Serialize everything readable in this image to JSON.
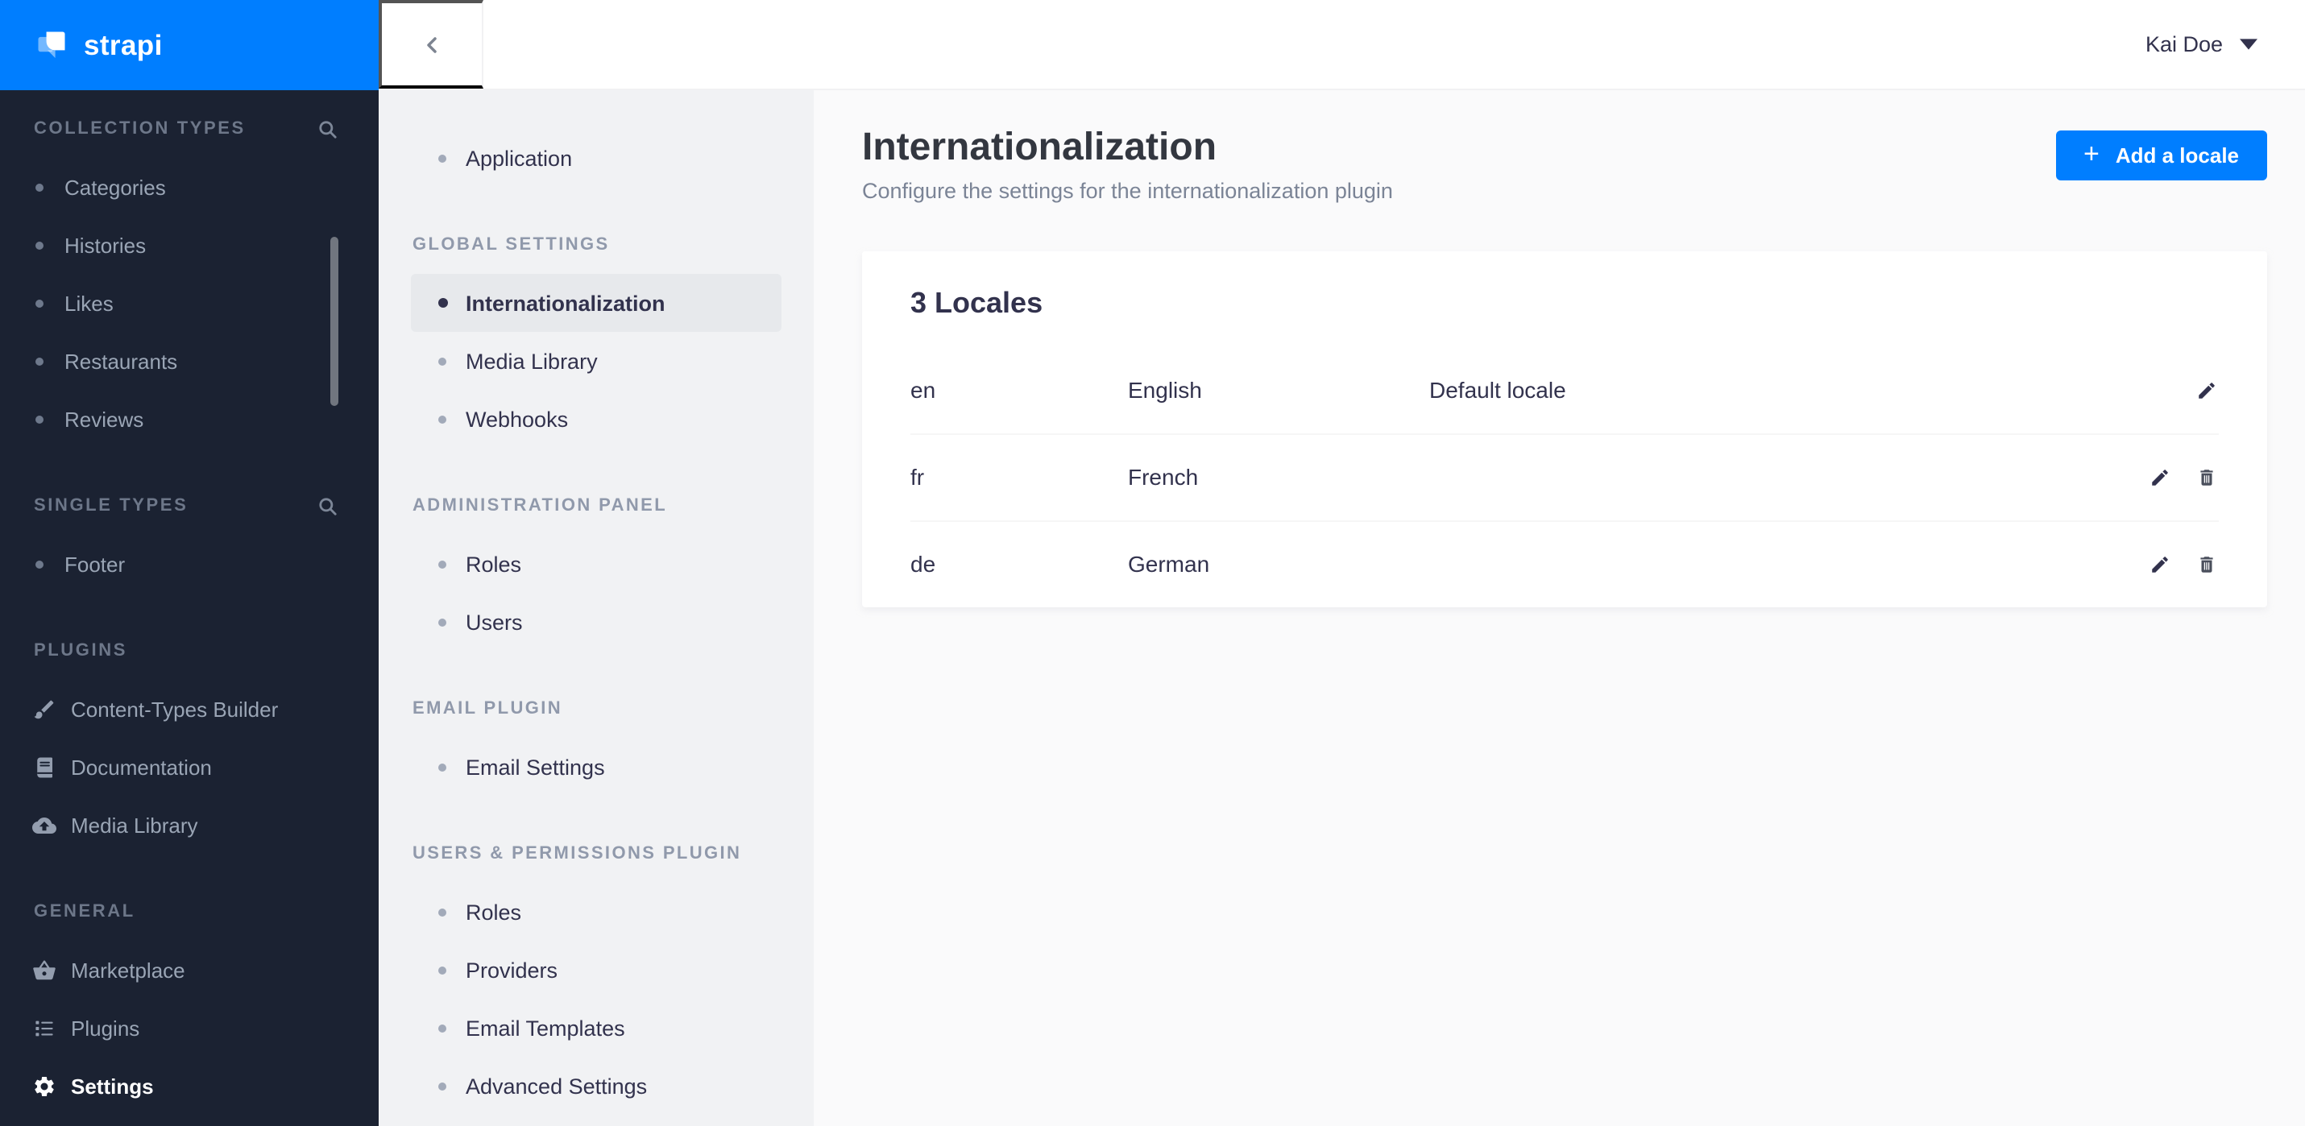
{
  "brand": {
    "logo_text": "strapi"
  },
  "topbar": {
    "user_name": "Kai Doe"
  },
  "main_nav": {
    "sections": [
      {
        "header": "COLLECTION TYPES",
        "items": [
          {
            "label": "Categories"
          },
          {
            "label": "Histories"
          },
          {
            "label": "Likes"
          },
          {
            "label": "Restaurants"
          },
          {
            "label": "Reviews"
          }
        ]
      },
      {
        "header": "SINGLE TYPES",
        "items": [
          {
            "label": "Footer"
          }
        ]
      },
      {
        "header": "PLUGINS",
        "items": [
          {
            "label": "Content-Types Builder"
          },
          {
            "label": "Documentation"
          },
          {
            "label": "Media Library"
          }
        ]
      },
      {
        "header": "GENERAL",
        "items": [
          {
            "label": "Marketplace"
          },
          {
            "label": "Plugins"
          },
          {
            "label": "Settings"
          }
        ]
      }
    ]
  },
  "settings_nav": {
    "sections": [
      {
        "items": [
          {
            "label": "Application"
          }
        ]
      },
      {
        "header": "GLOBAL SETTINGS",
        "items": [
          {
            "label": "Internationalization"
          },
          {
            "label": "Media Library"
          },
          {
            "label": "Webhooks"
          }
        ]
      },
      {
        "header": "ADMINISTRATION PANEL",
        "items": [
          {
            "label": "Roles"
          },
          {
            "label": "Users"
          }
        ]
      },
      {
        "header": "EMAIL PLUGIN",
        "items": [
          {
            "label": "Email Settings"
          }
        ]
      },
      {
        "header": "USERS & PERMISSIONS PLUGIN",
        "items": [
          {
            "label": "Roles"
          },
          {
            "label": "Providers"
          },
          {
            "label": "Email Templates"
          },
          {
            "label": "Advanced Settings"
          }
        ]
      }
    ]
  },
  "page": {
    "title": "Internationalization",
    "subtitle": "Configure the settings for the internationalization plugin",
    "add_plus": "+",
    "add_locale_button": "Add a locale"
  },
  "locales": {
    "card_title": "3 Locales",
    "rows": [
      {
        "code": "en",
        "name": "English",
        "badge": "Default locale"
      },
      {
        "code": "fr",
        "name": "French",
        "badge": ""
      },
      {
        "code": "de",
        "name": "German",
        "badge": ""
      }
    ]
  },
  "colors": {
    "primary_blue": "#007eff",
    "sidebar_dark_bg": "#1b2232",
    "sidebar_light_bg": "#f1f2f4",
    "selected_item_bg": "#e7e9ec",
    "main_bg": "#fafafb",
    "text_dark": "#32324d",
    "text_muted": "#7b8496",
    "nav_text": "#9aa5b5"
  }
}
